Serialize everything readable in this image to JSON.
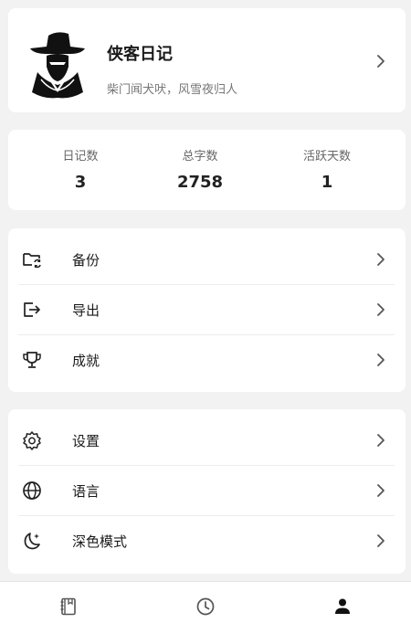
{
  "profile": {
    "name": "侠客日记",
    "motto": "柴门闻犬吠，风雪夜归人"
  },
  "stats": [
    {
      "label": "日记数",
      "value": "3"
    },
    {
      "label": "总字数",
      "value": "2758"
    },
    {
      "label": "活跃天数",
      "value": "1"
    }
  ],
  "menu_group_1": [
    {
      "label": "备份",
      "icon": "folder-sync-icon"
    },
    {
      "label": "导出",
      "icon": "export-icon"
    },
    {
      "label": "成就",
      "icon": "trophy-icon"
    }
  ],
  "menu_group_2": [
    {
      "label": "设置",
      "icon": "gear-icon"
    },
    {
      "label": "语言",
      "icon": "globe-icon"
    },
    {
      "label": "深色模式",
      "icon": "moon-icon"
    }
  ],
  "bottom_nav": [
    {
      "icon": "diary-icon",
      "active": false
    },
    {
      "icon": "clock-icon",
      "active": false
    },
    {
      "icon": "person-icon",
      "active": true
    }
  ],
  "colors": {
    "background": "#f2f2f2",
    "card": "#ffffff",
    "text": "#1a1a1a",
    "secondary_text": "#777777",
    "inactive_nav": "#555555",
    "active_nav": "#111111"
  }
}
